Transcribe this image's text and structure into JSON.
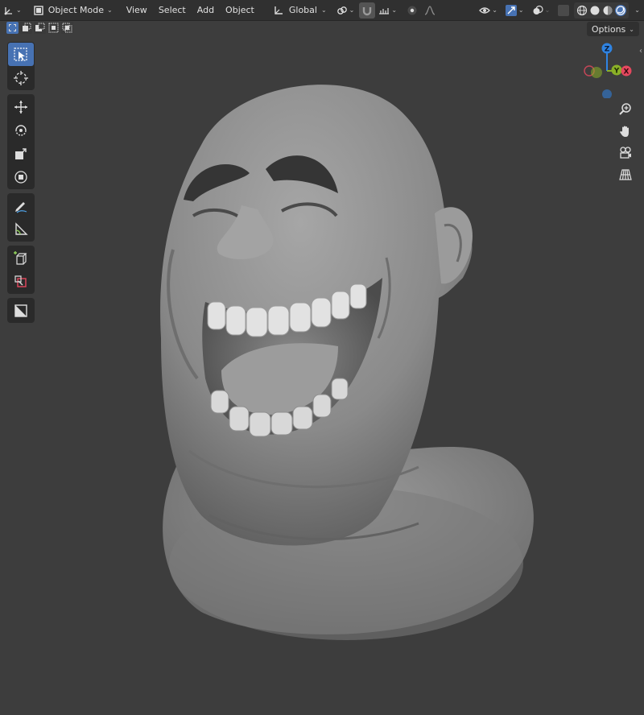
{
  "header": {
    "mode_label": "Object Mode",
    "menus": [
      "View",
      "Select",
      "Add",
      "Object"
    ],
    "transform_orientation": "Global"
  },
  "subheader": {
    "options_label": "Options"
  },
  "gizmo": {
    "z_label": "Z",
    "y_label": "Y",
    "x_label": "X",
    "colors": {
      "x": "#e5485e",
      "y": "#8ab027",
      "z": "#2f84e3"
    }
  },
  "toolbar": {
    "tools": [
      "select-box",
      "cursor",
      "move",
      "rotate",
      "scale",
      "transform",
      "annotate",
      "measure",
      "add-cube",
      "add-object",
      "scene-toggle"
    ],
    "active_tool": "select-box"
  },
  "colors": {
    "accent": "#4772b3",
    "background": "#3d3d3d",
    "header": "#303030"
  }
}
